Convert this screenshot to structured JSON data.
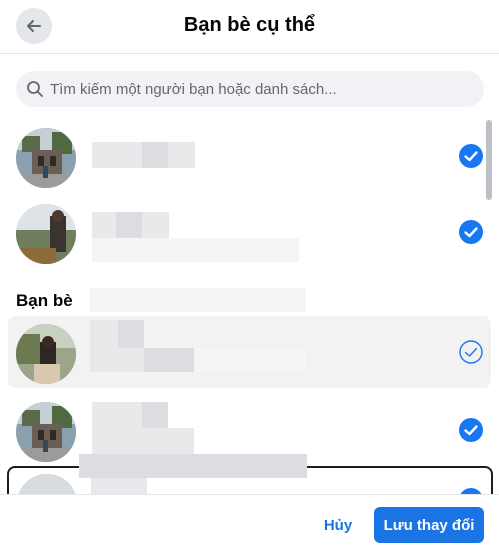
{
  "header": {
    "title": "Bạn bè cụ thể",
    "back_icon": "arrow-left-icon"
  },
  "search": {
    "placeholder": "Tìm kiếm một người bạn hoặc danh sách...",
    "value": ""
  },
  "selected_section": {
    "friends": [
      {
        "name": "",
        "checked": true
      },
      {
        "name": "",
        "checked": true
      }
    ]
  },
  "friends_section": {
    "title": "Bạn bè",
    "friends": [
      {
        "name": "",
        "checked": false
      },
      {
        "name": "",
        "checked": true
      },
      {
        "name": "",
        "checked": true
      }
    ]
  },
  "footer": {
    "cancel_label": "Hủy",
    "save_label": "Lưu thay đổi"
  },
  "colors": {
    "accent": "#1b74e4",
    "check_fill": "#1877f2",
    "row_highlight": "#f2f2f2"
  }
}
